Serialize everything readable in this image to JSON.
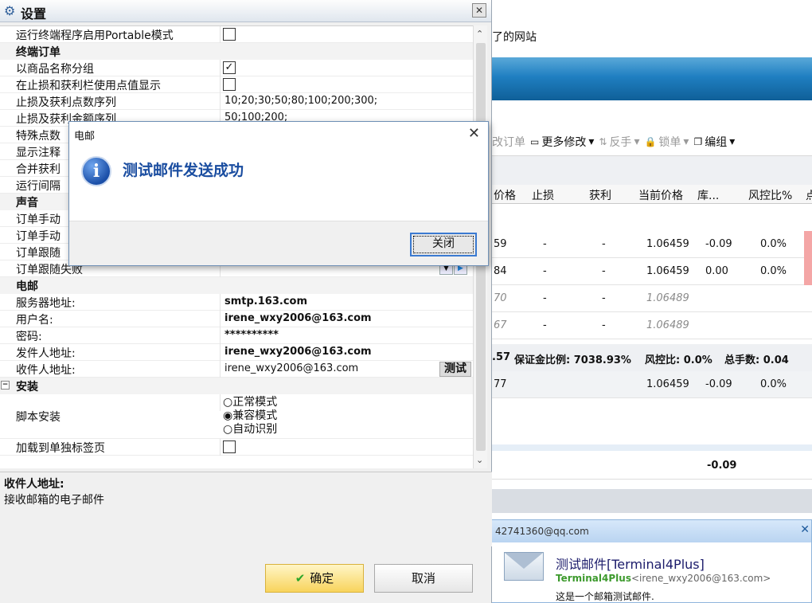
{
  "background": {
    "site_text": "了的网站",
    "toolbar": [
      {
        "icon": "edit-order-icon",
        "label": "改订单",
        "disabled": true
      },
      {
        "icon": "more-edit-icon",
        "label": "更多修改",
        "disabled": false
      },
      {
        "icon": "reverse-icon",
        "label": "反手",
        "disabled": true
      },
      {
        "icon": "lock-icon",
        "label": "锁单",
        "disabled": true
      },
      {
        "icon": "group-icon",
        "label": "编组",
        "disabled": false
      }
    ],
    "columns": [
      "价格",
      "止损",
      "获利",
      "当前价格",
      "库...",
      "风控比%",
      "点"
    ],
    "rows": [
      {
        "price": "59",
        "sl": "-",
        "tp": "-",
        "cur": "1.06459",
        "lib": "-0.09",
        "risk": "0.0%",
        "italic": false
      },
      {
        "price": "84",
        "sl": "-",
        "tp": "-",
        "cur": "1.06459",
        "lib": "0.00",
        "risk": "0.0%",
        "italic": false
      },
      {
        "price": "70",
        "sl": "-",
        "tp": "-",
        "cur": "1.06489",
        "lib": "",
        "risk": "",
        "italic": true
      },
      {
        "price": "67",
        "sl": "-",
        "tp": "-",
        "cur": "1.06489",
        "lib": "",
        "risk": "",
        "italic": true
      }
    ],
    "summary": {
      "a": ".57",
      "margin": "保证金比例: 7038.93%",
      "risk": "风控比: 0.0%",
      "lots": "总手数: 0.04"
    },
    "summary_row": {
      "price": "77",
      "cur": "1.06459",
      "lib": "-0.09",
      "risk": "0.0%"
    },
    "total": "-0.09"
  },
  "settings": {
    "title": "设置",
    "rows": [
      {
        "type": "prop",
        "name": "运行终端程序启用Portable模式",
        "check": false
      },
      {
        "type": "cat",
        "name": "终端订单"
      },
      {
        "type": "prop",
        "name": "以商品名称分组",
        "check": true
      },
      {
        "type": "prop",
        "name": "在止损和获利栏使用点值显示",
        "check": false
      },
      {
        "type": "prop",
        "name": "止损及获利点数序列",
        "value": "10;20;30;50;80;100;200;300;"
      },
      {
        "type": "prop",
        "name": "止损及获利金额序列",
        "value": "50;100;200;"
      },
      {
        "type": "prop",
        "name": "特殊点数",
        "value": ""
      },
      {
        "type": "prop",
        "name": "显示注释",
        "value": ""
      },
      {
        "type": "prop",
        "name": "合并获利",
        "value": ""
      },
      {
        "type": "prop",
        "name": "运行间隔",
        "value": ""
      },
      {
        "type": "cat",
        "name": "声音"
      },
      {
        "type": "prop",
        "name": "订单手动",
        "value": ""
      },
      {
        "type": "prop",
        "name": "订单手动",
        "value": ""
      },
      {
        "type": "prop",
        "name": "订单跟随",
        "value": ""
      },
      {
        "type": "sound",
        "name": "订单跟随失败"
      },
      {
        "type": "cat",
        "name": "电邮"
      },
      {
        "type": "prop",
        "name": "服务器地址:",
        "value": "smtp.163.com",
        "bold": true
      },
      {
        "type": "prop",
        "name": "用户名:",
        "value": "irene_wxy2006@163.com",
        "bold": true
      },
      {
        "type": "prop",
        "name": "密码:",
        "value": "**********",
        "bold": true
      },
      {
        "type": "prop",
        "name": "发件人地址:",
        "value": "irene_wxy2006@163.com",
        "bold": true
      },
      {
        "type": "test",
        "name": "收件人地址:",
        "value": "irene_wxy2006@163.com",
        "button": "测试"
      }
    ],
    "install": {
      "category": "安装",
      "script_label": "脚本安装",
      "options": [
        "正常模式",
        "兼容模式",
        "自动识别"
      ],
      "selected": 1,
      "tab_label": "加载到单独标签页"
    },
    "description": {
      "title": "收件人地址:",
      "text": "接收邮箱的电子邮件"
    },
    "ok_label": "确定",
    "cancel_label": "取消"
  },
  "messagebox": {
    "title": "电邮",
    "message": "测试邮件发送成功",
    "button": "关闭"
  },
  "toast": {
    "account": "42741360@qq.com",
    "subject": "测试邮件[Terminal4Plus]",
    "sender_name": "Terminal4Plus",
    "sender_addr": "<irene_wxy2006@163.com>",
    "body": "这是一个邮箱测试邮件."
  }
}
